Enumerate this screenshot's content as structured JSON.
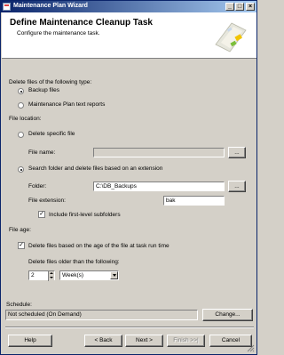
{
  "window": {
    "title": "Maintenance Plan Wizard",
    "controls": {
      "minimize": "_",
      "maximize": "□",
      "close": "×"
    }
  },
  "header": {
    "title": "Define Maintenance Cleanup Task",
    "subtitle": "Configure the maintenance task."
  },
  "delete_type": {
    "heading": "Delete files of the following type:",
    "options": [
      {
        "label": "Backup files",
        "selected": true
      },
      {
        "label": "Maintenance Plan text reports",
        "selected": false
      }
    ]
  },
  "file_location": {
    "heading": "File location:",
    "delete_specific": {
      "label": "Delete specific file",
      "selected": false
    },
    "file_name": {
      "label": "File name:",
      "value": "",
      "browse_label": "..."
    },
    "search_folder": {
      "label": "Search folder and delete files based on an extension",
      "selected": true
    },
    "folder": {
      "label": "Folder:",
      "value": "C:\\DB_Backups",
      "browse_label": "..."
    },
    "file_extension": {
      "label": "File extension:",
      "value": "bak"
    },
    "include_subfolders": {
      "label": "Include first-level subfolders",
      "checked": true
    }
  },
  "file_age": {
    "heading": "File age:",
    "delete_by_age": {
      "label": "Delete files based on the age of the file at task run time",
      "checked": true
    },
    "older_than_label": "Delete files older than the following:",
    "amount": "2",
    "unit": "Week(s)"
  },
  "schedule": {
    "label": "Schedule:",
    "value": "Not scheduled (On Demand)",
    "change_label": "Change..."
  },
  "footer": {
    "help": "Help",
    "back": "< Back",
    "next": "Next >",
    "finish": "Finish >>|",
    "cancel": "Cancel"
  },
  "colors": {
    "titlebar_start": "#0a246a",
    "titlebar_end": "#a6caf0",
    "dialog_bg": "#d4d0c8"
  }
}
